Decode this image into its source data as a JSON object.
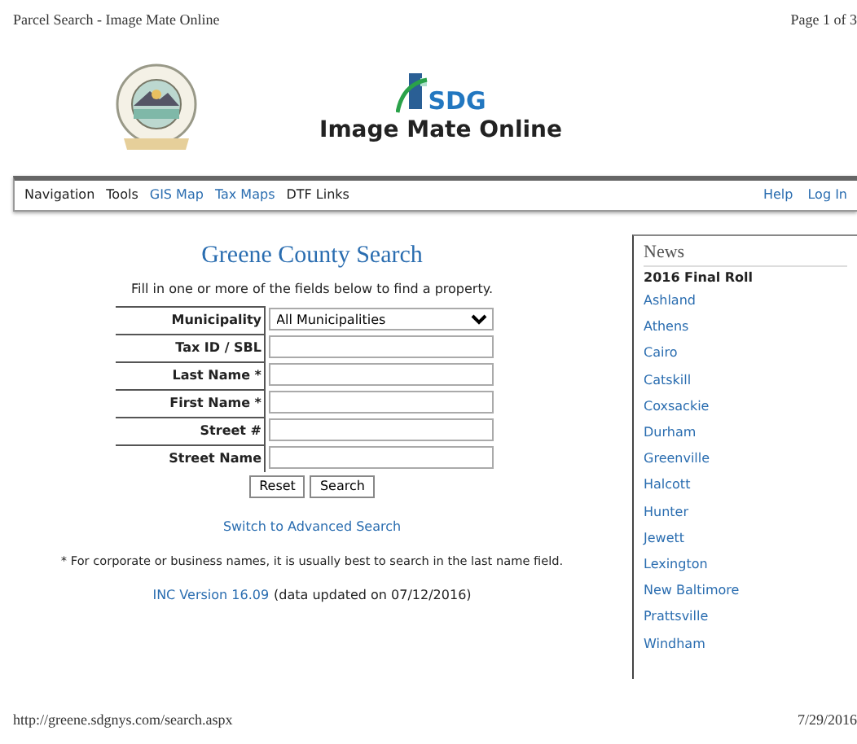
{
  "print_header": {
    "title": "Parcel Search - Image Mate Online",
    "page": "Page 1 of 3"
  },
  "site_title": "Image Mate Online",
  "logo_text": "SDG",
  "nav": {
    "left": [
      {
        "label": "Navigation",
        "kind": "menu"
      },
      {
        "label": "Tools",
        "kind": "menu"
      },
      {
        "label": "GIS Map",
        "kind": "link"
      },
      {
        "label": "Tax Maps",
        "kind": "link"
      },
      {
        "label": "DTF Links",
        "kind": "menu"
      }
    ],
    "right": [
      {
        "label": "Help",
        "kind": "link"
      },
      {
        "label": "Log In",
        "kind": "link"
      }
    ]
  },
  "search": {
    "title": "Greene County Search",
    "intro": "Fill in one or more of the fields below to find a property.",
    "fields": [
      {
        "label": "Municipality",
        "kind": "select",
        "value": "All Municipalities"
      },
      {
        "label": "Tax ID / SBL",
        "kind": "text"
      },
      {
        "label": "Last Name *",
        "kind": "text"
      },
      {
        "label": "First Name *",
        "kind": "text"
      },
      {
        "label": "Street #",
        "kind": "text"
      },
      {
        "label": "Street Name",
        "kind": "text"
      }
    ],
    "buttons": [
      "Reset",
      "Search"
    ],
    "advanced_link": "Switch to Advanced Search",
    "note": "* For corporate or business names, it is usually best to search in the last name field.",
    "version_link": "INC Version 16.09",
    "version_text": "(data updated on 07/12/2016)"
  },
  "news": {
    "title": "News",
    "heading": "2016 Final Roll",
    "items": [
      "Ashland",
      "Athens",
      "Cairo",
      "Catskill",
      "Coxsackie",
      "Durham",
      "Greenville",
      "Halcott",
      "Hunter",
      "Jewett",
      "Lexington",
      "New Baltimore",
      "Prattsville",
      "Windham"
    ]
  },
  "print_footer": {
    "url": "http://greene.sdgnys.com/search.aspx",
    "date": "7/29/2016"
  }
}
